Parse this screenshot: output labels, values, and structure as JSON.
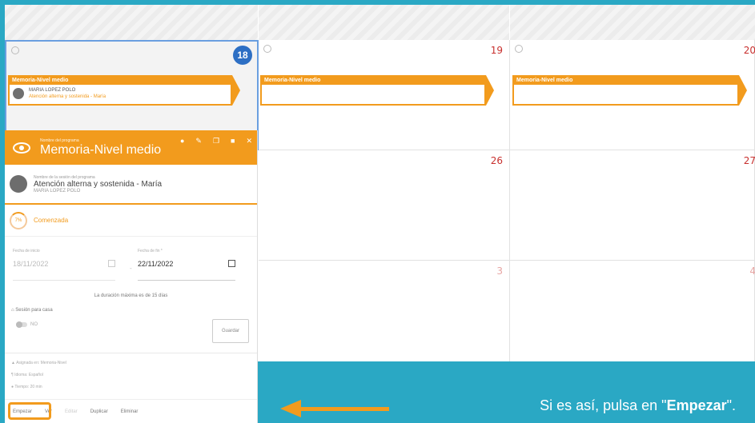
{
  "calendar": {
    "days": [
      {
        "num": "18",
        "today": true
      },
      {
        "num": "19"
      },
      {
        "num": "20"
      },
      {
        "num": "26"
      },
      {
        "num": "27"
      },
      {
        "num": "3"
      },
      {
        "num": "4"
      }
    ],
    "events": [
      {
        "title": "Memoria-Nivel medio",
        "patient": "MARIA LOPEZ POLO",
        "session": "Atención alterna y sostenida - María"
      },
      {
        "title": "Memoria-Nivel medio"
      },
      {
        "title": "Memoria-Nivel medio"
      }
    ]
  },
  "popup": {
    "program_label": "Nombre del programa",
    "program_title": "Memoria-Nivel medio",
    "session_label": "Nombre de la sesión del programa",
    "session_name": "Atención alterna y sostenida - María",
    "patient": "MARIA LOPEZ POLO",
    "progress": "7%",
    "status": "Comenzada",
    "start_label": "Fecha de inicio",
    "start_value": "18/11/2022",
    "end_label": "Fecha de fin *",
    "end_value": "22/11/2022",
    "duration_note": "La duración máxima es de 15 días",
    "home_label": "Sesión para casa",
    "home_value": "NO",
    "save_label": "Guardar",
    "meta": [
      "Asignada en: Memoria-Nivel",
      "Idioma: Español",
      "Tiempo: 20 min"
    ],
    "actions": [
      "Empezar",
      "Ver",
      "Editar",
      "Duplicar",
      "Eliminar"
    ]
  },
  "callout": {
    "prefix": "Si es así, pulsa en \"",
    "bold": "Empezar",
    "suffix": "\"."
  },
  "colors": {
    "accent": "#f29b1d",
    "teal": "#2aa8c4",
    "today": "#2d6fc4",
    "day_number": "#c8302e"
  }
}
